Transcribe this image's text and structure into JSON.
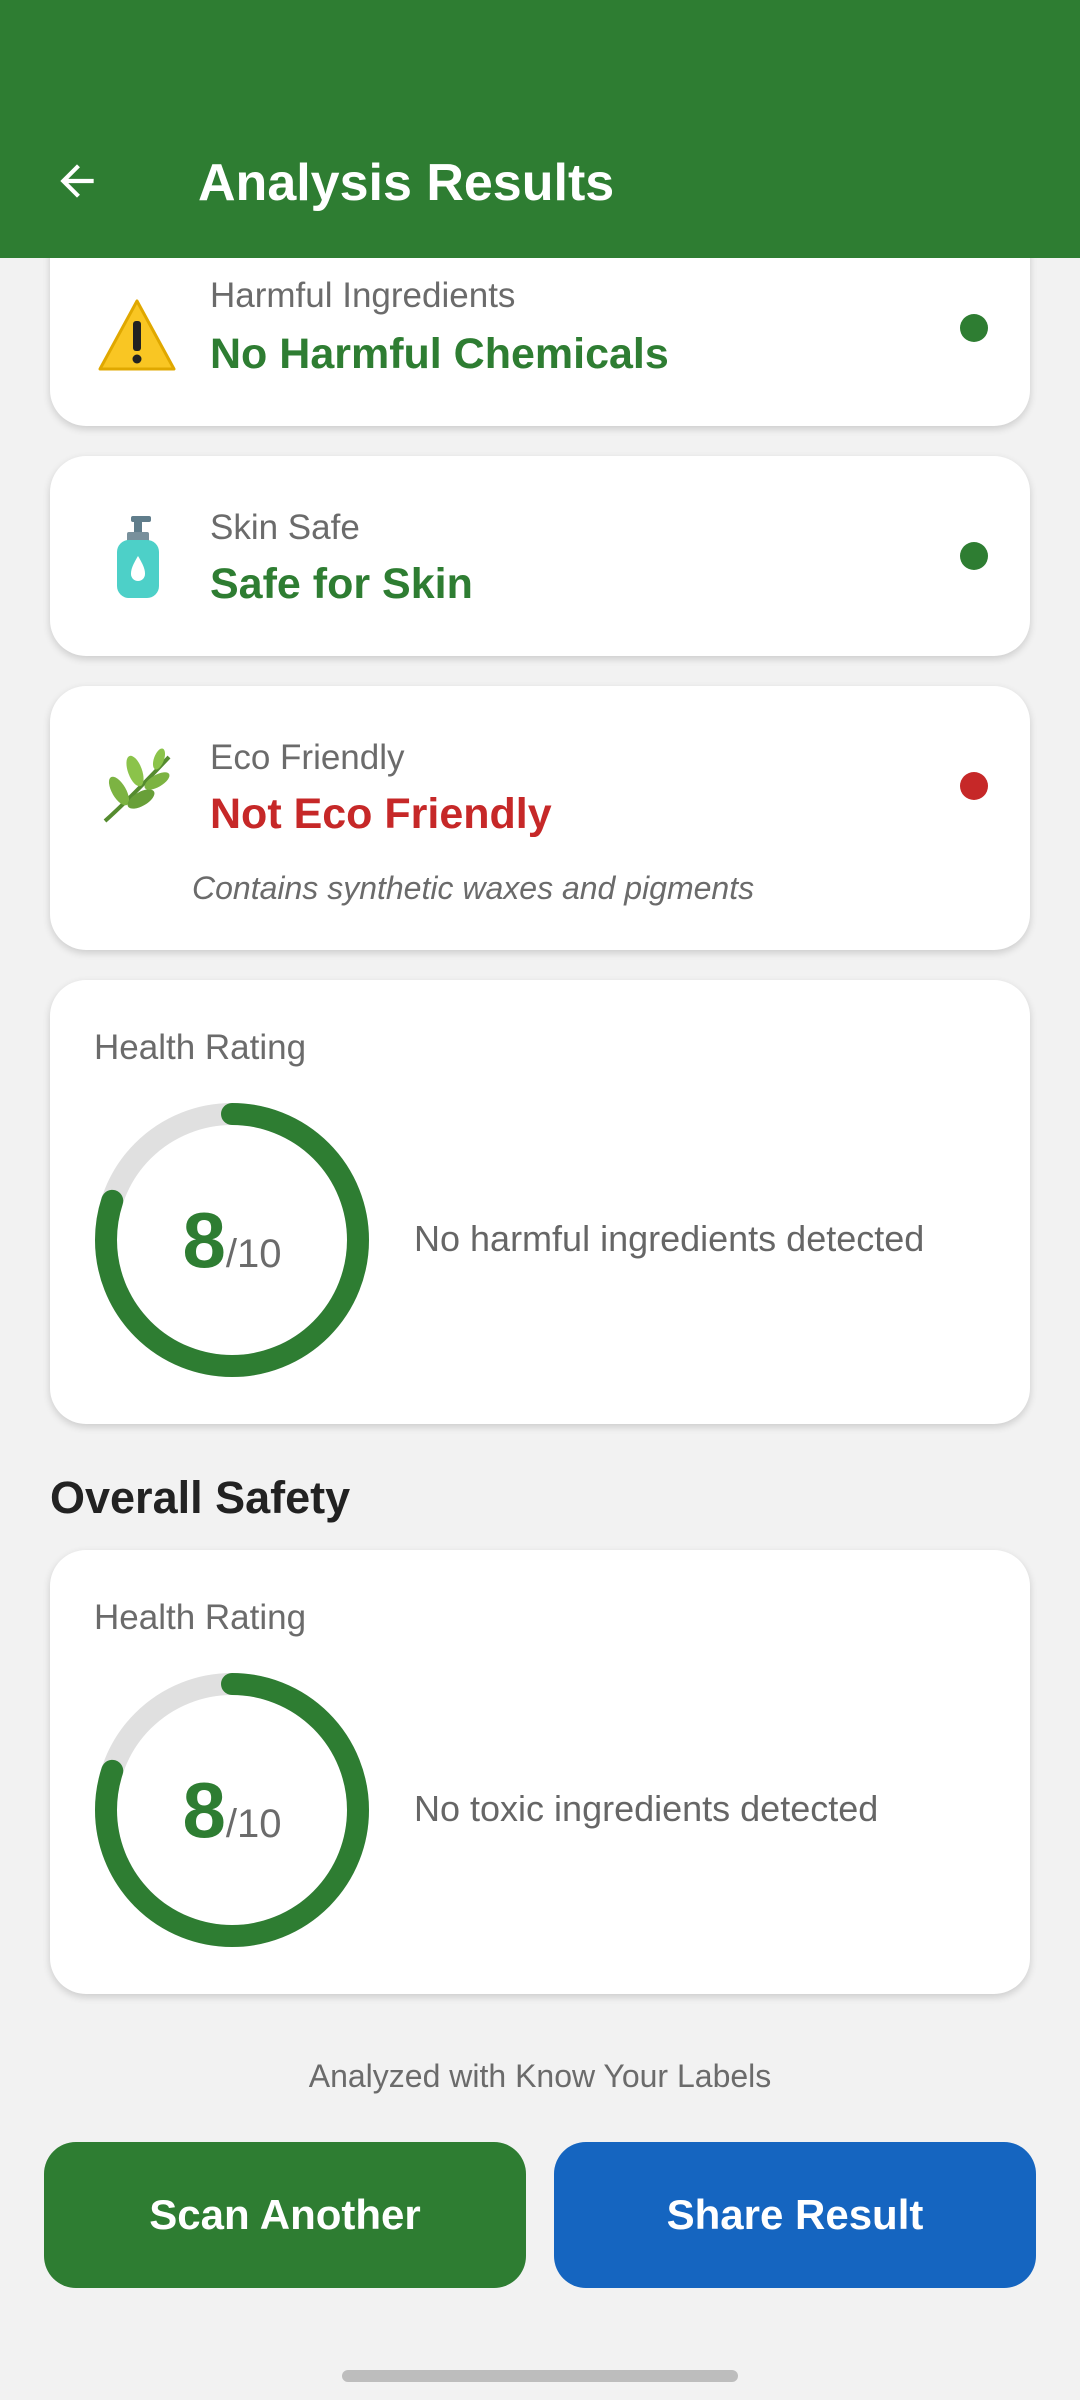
{
  "header": {
    "title": "Analysis Results",
    "back_icon": "arrow-left-icon",
    "color": "#2e7d32"
  },
  "cards": [
    {
      "icon": "warning-icon",
      "label": "Harmful Ingredients",
      "value": "No Harmful Chemicals",
      "status": "good",
      "status_color": "#2e7d32"
    },
    {
      "icon": "lotion-bottle-icon",
      "label": "Skin Safe",
      "value": "Safe for Skin",
      "status": "good",
      "status_color": "#2e7d32"
    },
    {
      "icon": "herb-icon",
      "label": "Eco Friendly",
      "value": "Not Eco Friendly",
      "status": "bad",
      "status_color": "#c62828",
      "note": "Contains synthetic waxes and pigments"
    }
  ],
  "health_rating": {
    "label": "Health Rating",
    "score": "8",
    "max": "/10",
    "score_fraction": 0.8,
    "description": "No harmful ingredients detected"
  },
  "overall_safety": {
    "title": "Overall Safety",
    "label": "Health Rating",
    "score": "8",
    "max": "/10",
    "score_fraction": 0.8,
    "description": "No toxic ingredients detected"
  },
  "footer_text": "Analyzed with Know Your Labels",
  "buttons": {
    "scan_another": "Scan Another",
    "scan_color": "#2e7d32",
    "share_result": "Share Result",
    "share_color": "#1565c0"
  }
}
